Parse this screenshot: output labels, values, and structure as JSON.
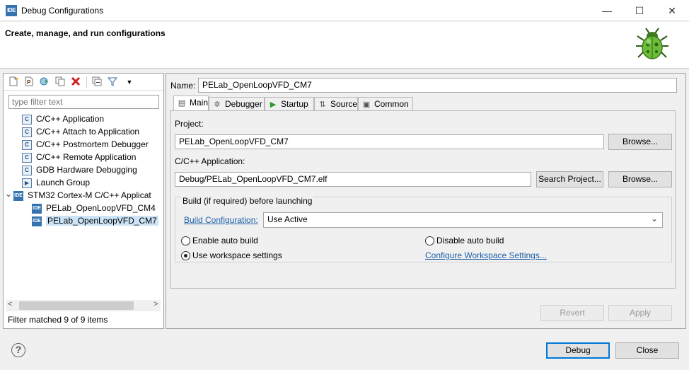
{
  "window": {
    "app_icon": "IDE",
    "title": "Debug Configurations",
    "minimize_glyph": "—",
    "maximize_glyph": "☐",
    "close_glyph": "✕"
  },
  "header": {
    "title": "Create, manage, and run configurations",
    "icon": "bug-icon"
  },
  "sidebar": {
    "toolbar_icons": [
      "new-config-icon",
      "new-prototype-icon",
      "export-icon",
      "duplicate-icon",
      "delete-icon",
      "collapse-all-icon",
      "filter-icon",
      "view-menu-icon"
    ],
    "filter_placeholder": "type filter text",
    "tree": [
      {
        "label": "C/C++ Application",
        "icon": "C",
        "indent": 1
      },
      {
        "label": "C/C++ Attach to Application",
        "icon": "C",
        "indent": 1
      },
      {
        "label": "C/C++ Postmortem Debugger",
        "icon": "C",
        "indent": 1
      },
      {
        "label": "C/C++ Remote Application",
        "icon": "C",
        "indent": 1
      },
      {
        "label": "GDB Hardware Debugging",
        "icon": "C",
        "indent": 1
      },
      {
        "label": "Launch Group",
        "icon": "▶",
        "indent": 1
      },
      {
        "label": "STM32 Cortex-M C/C++ Applicat",
        "icon": "IDE",
        "indent": 0,
        "expanded": true
      },
      {
        "label": "PELab_OpenLoopVFD_CM4",
        "icon": "IDE",
        "indent": 2
      },
      {
        "label": "PELab_OpenLoopVFD_CM7",
        "icon": "IDE",
        "indent": 2,
        "selected": true
      }
    ],
    "expander_glyph": "⌄",
    "scroll_left": "<",
    "scroll_right": ">",
    "filter_status": "Filter matched 9 of 9 items"
  },
  "config": {
    "name_label": "Name:",
    "name_value": "PELab_OpenLoopVFD_CM7",
    "tabs": [
      {
        "label": "Main",
        "icon": "main-tab-icon",
        "glyph": "▤",
        "active": true
      },
      {
        "label": "Debugger",
        "icon": "debugger-tab-icon",
        "glyph": "✲"
      },
      {
        "label": "Startup",
        "icon": "startup-tab-icon",
        "glyph": "▶"
      },
      {
        "label": "Source",
        "icon": "source-tab-icon",
        "glyph": "⇅"
      },
      {
        "label": "Common",
        "icon": "common-tab-icon",
        "glyph": "▣"
      }
    ],
    "project_label": "Project:",
    "project_value": "PELab_OpenLoopVFD_CM7",
    "browse_label": "Browse...",
    "app_label": "C/C++ Application:",
    "app_value": "Debug/PELab_OpenLoopVFD_CM7.elf",
    "search_project_label": "Search Project...",
    "build_group_label": "Build (if required) before launching",
    "build_config_link": "Build Configuration:",
    "build_config_value": "Use Active",
    "dropdown_glyph": "⌄",
    "enable_auto_build": "Enable auto build",
    "disable_auto_build": "Disable auto build",
    "use_workspace_settings": "Use workspace settings",
    "configure_workspace_link": "Configure Workspace Settings...",
    "revert_label": "Revert",
    "apply_label": "Apply"
  },
  "footer": {
    "help_glyph": "?",
    "debug_label": "Debug",
    "close_label": "Close"
  }
}
